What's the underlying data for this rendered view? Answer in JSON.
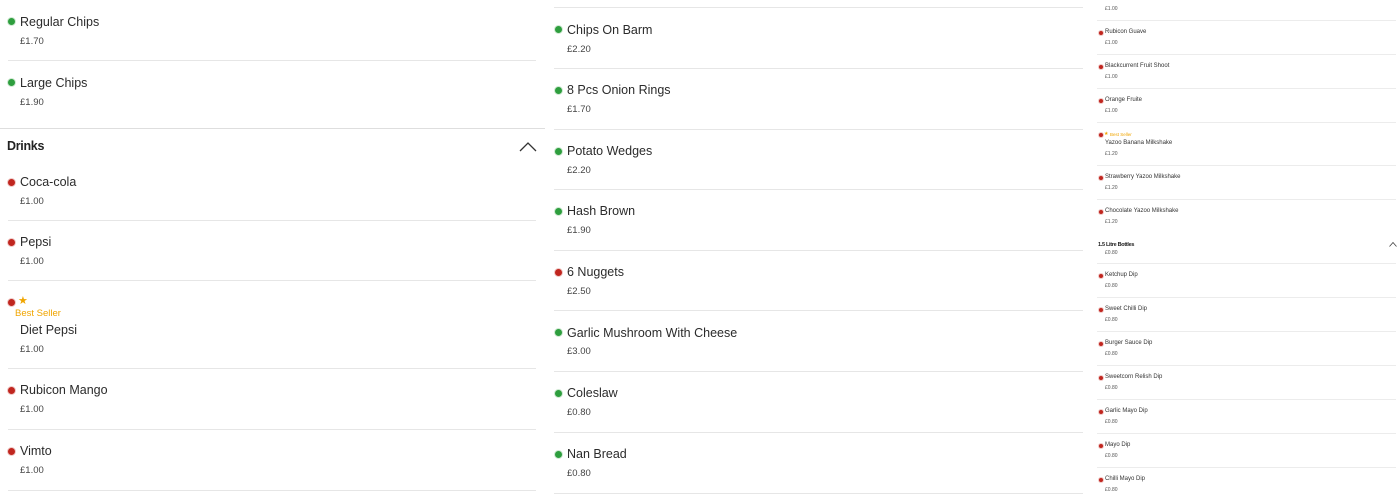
{
  "column1": {
    "top_items": [
      {
        "name": "Regular Chips",
        "price": "£1.70",
        "type": "veg"
      },
      {
        "name": "Large Chips",
        "price": "£1.90",
        "type": "veg"
      }
    ],
    "drinks_section": {
      "title": "Drinks",
      "toggle_icon": "chevron-up-icon",
      "items": [
        {
          "name": "Coca-cola",
          "price": "£1.00",
          "type": "nonveg"
        },
        {
          "name": "Pepsi",
          "price": "£1.00",
          "type": "nonveg"
        },
        {
          "name": "Diet Pepsi",
          "price": "£1.00",
          "type": "nonveg",
          "badge": "Best Seller"
        },
        {
          "name": "Rubicon Mango",
          "price": "£1.00",
          "type": "nonveg"
        },
        {
          "name": "Vimto",
          "price": "£1.00",
          "type": "nonveg"
        }
      ]
    }
  },
  "column2": {
    "items": [
      {
        "name": "Chips On Barm",
        "price": "£2.20",
        "type": "veg"
      },
      {
        "name": "8 Pcs Onion Rings",
        "price": "£1.70",
        "type": "veg"
      },
      {
        "name": "Potato Wedges",
        "price": "£2.20",
        "type": "veg"
      },
      {
        "name": "Hash Brown",
        "price": "£1.90",
        "type": "veg"
      },
      {
        "name": "6 Nuggets",
        "price": "£2.50",
        "type": "nonveg"
      },
      {
        "name": "Garlic Mushroom With Cheese",
        "price": "£3.00",
        "type": "veg"
      },
      {
        "name": "Coleslaw",
        "price": "£0.80",
        "type": "veg"
      },
      {
        "name": "Nan Bread",
        "price": "£0.80",
        "type": "veg"
      }
    ]
  },
  "column3": {
    "top_price": "£1.00",
    "items_a": [
      {
        "name": "Rubicon Guave",
        "price": "£1.00",
        "type": "nonveg"
      },
      {
        "name": "Blackcurrent Fruit Shoot",
        "price": "£1.00",
        "type": "nonveg"
      },
      {
        "name": "Orange Fruite",
        "price": "£1.00",
        "type": "nonveg"
      },
      {
        "name": "Yazoo Banana Milkshake",
        "price": "£1.20",
        "type": "nonveg",
        "badge": "Best Seller"
      },
      {
        "name": "Strawberry Yazoo Milkshake",
        "price": "£1.20",
        "type": "nonveg"
      },
      {
        "name": "Chocolate Yazoo Milkshake",
        "price": "£1.20",
        "type": "nonveg"
      }
    ],
    "section_title": "1.5 Litre Bottles",
    "section_toggle_icon": "chevron-up-icon",
    "clipped_price": "£0.80",
    "items_b": [
      {
        "name": "Ketchup Dip",
        "price": "£0.80",
        "type": "nonveg"
      },
      {
        "name": "Sweet Chilli Dip",
        "price": "£0.80",
        "type": "nonveg"
      },
      {
        "name": "Burger Sauce Dip",
        "price": "£0.80",
        "type": "nonveg"
      },
      {
        "name": "Sweetcorn Relish Dip",
        "price": "£0.80",
        "type": "nonveg"
      },
      {
        "name": "Garlic Mayo Dip",
        "price": "£0.80",
        "type": "nonveg"
      },
      {
        "name": "Mayo Dip",
        "price": "£0.80",
        "type": "nonveg"
      },
      {
        "name": "Chilli Mayo Dip",
        "price": "£0.80",
        "type": "nonveg"
      }
    ]
  },
  "colors": {
    "veg": "#2e9e3e",
    "nonveg": "#c0261f",
    "best_seller": "#f0a500"
  }
}
